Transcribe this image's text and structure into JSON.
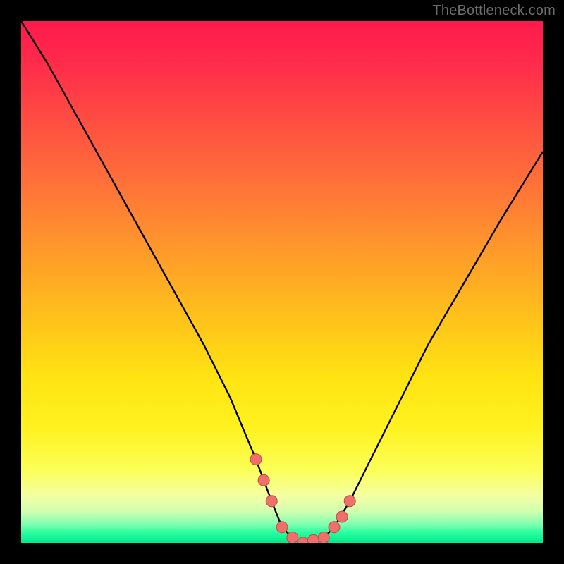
{
  "watermark": "TheBottleneck.com",
  "colors": {
    "frame": "#000000",
    "curve": "#000000",
    "dot_fill": "#ef6f6a",
    "dot_stroke": "#c04a45",
    "gradient_top": "#ff1a4d",
    "gradient_bottom": "#00e88a"
  },
  "chart_data": {
    "type": "line",
    "title": "",
    "xlabel": "",
    "ylabel": "",
    "xlim": [
      0,
      100
    ],
    "ylim": [
      0,
      100
    ],
    "grid": false,
    "legend": false,
    "series": [
      {
        "name": "bottleneck-curve",
        "x": [
          0,
          5,
          10,
          15,
          20,
          25,
          30,
          35,
          40,
          45,
          48,
          50,
          52,
          55,
          58,
          60,
          63,
          67,
          72,
          78,
          85,
          92,
          100
        ],
        "values": [
          100,
          92,
          83,
          74,
          65,
          56,
          47,
          38,
          28,
          16,
          8,
          3,
          1,
          0,
          1,
          3,
          8,
          16,
          26,
          38,
          50,
          62,
          75
        ]
      }
    ],
    "markers": {
      "name": "valley-dots",
      "x": [
        45,
        46.5,
        48,
        50,
        52,
        54,
        56,
        58,
        60,
        61.5,
        63
      ],
      "values": [
        16,
        12,
        8,
        3,
        1,
        0,
        0.5,
        1,
        3,
        5,
        8
      ]
    }
  }
}
